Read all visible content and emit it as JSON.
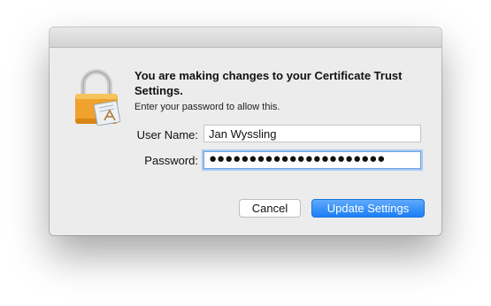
{
  "dialog": {
    "heading": "You are making changes to your Certificate Trust Settings.",
    "subtext": "Enter your password to allow this.",
    "icon": "lock-icon"
  },
  "form": {
    "username_label": "User Name:",
    "username_value": "Jan Wyssling",
    "password_label": "Password:",
    "password_mask": "●●●●●●●●●●●●●●●●●●●●●●"
  },
  "buttons": {
    "cancel_label": "Cancel",
    "confirm_label": "Update Settings"
  },
  "colors": {
    "dialog_bg": "#ececec",
    "primary_button": "#1c7ff5",
    "focus_ring": "#a9c9f0",
    "lock_gold": "#f0a22e"
  }
}
